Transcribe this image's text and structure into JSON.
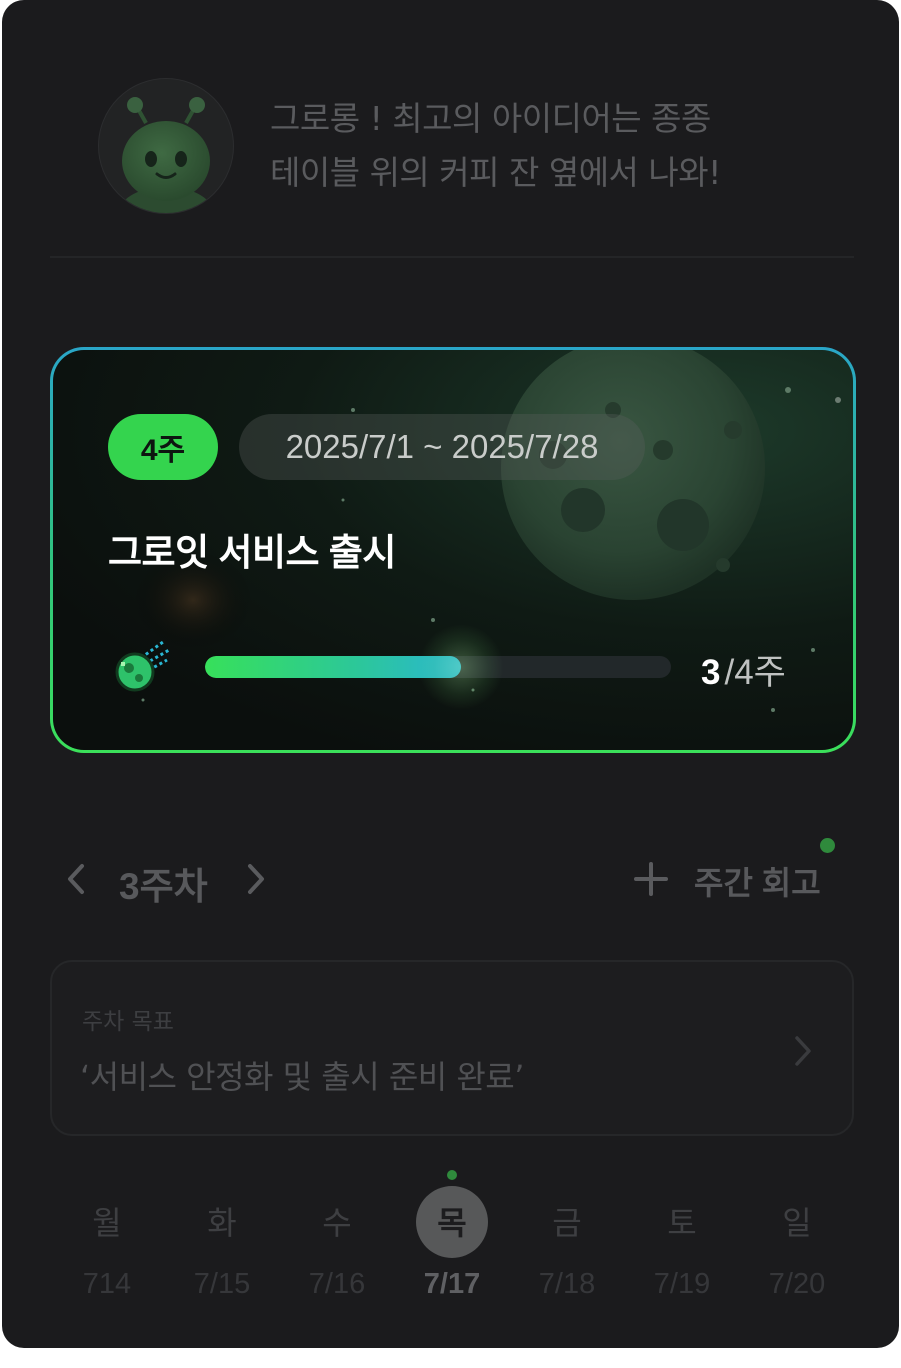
{
  "header": {
    "quote_line1": "그로롱 ! 최고의 아이디어는 종종",
    "quote_line2": "테이블 위의 커피 잔 옆에서 나와!"
  },
  "goal_card": {
    "duration_badge": "4주",
    "date_range": "2025/7/1 ~ 2025/7/28",
    "title": "그로잇 서비스 출시",
    "progress": {
      "current": "3",
      "total_label": "/4주",
      "fraction": 0.75
    },
    "colors": {
      "accent_green": "#34d44e",
      "accent_blue": "#2ab6d2"
    }
  },
  "week_nav": {
    "prev_icon": "chevron-left-icon",
    "week_label": "3주차",
    "next_icon": "chevron-right-icon",
    "review_icon": "plus-icon",
    "review_label": "주간 회고"
  },
  "weekly_goal": {
    "label": "주차 목표",
    "text": "‘서비스 안정화 및 출시 준비 완료’"
  },
  "days": [
    {
      "name": "월",
      "date": "714",
      "selected": false,
      "has_dot": false
    },
    {
      "name": "화",
      "date": "7/15",
      "selected": false,
      "has_dot": false
    },
    {
      "name": "수",
      "date": "7/16",
      "selected": false,
      "has_dot": false
    },
    {
      "name": "목",
      "date": "7/17",
      "selected": true,
      "has_dot": true
    },
    {
      "name": "금",
      "date": "7/18",
      "selected": false,
      "has_dot": false
    },
    {
      "name": "토",
      "date": "7/19",
      "selected": false,
      "has_dot": false
    },
    {
      "name": "일",
      "date": "7/20",
      "selected": false,
      "has_dot": false
    }
  ]
}
